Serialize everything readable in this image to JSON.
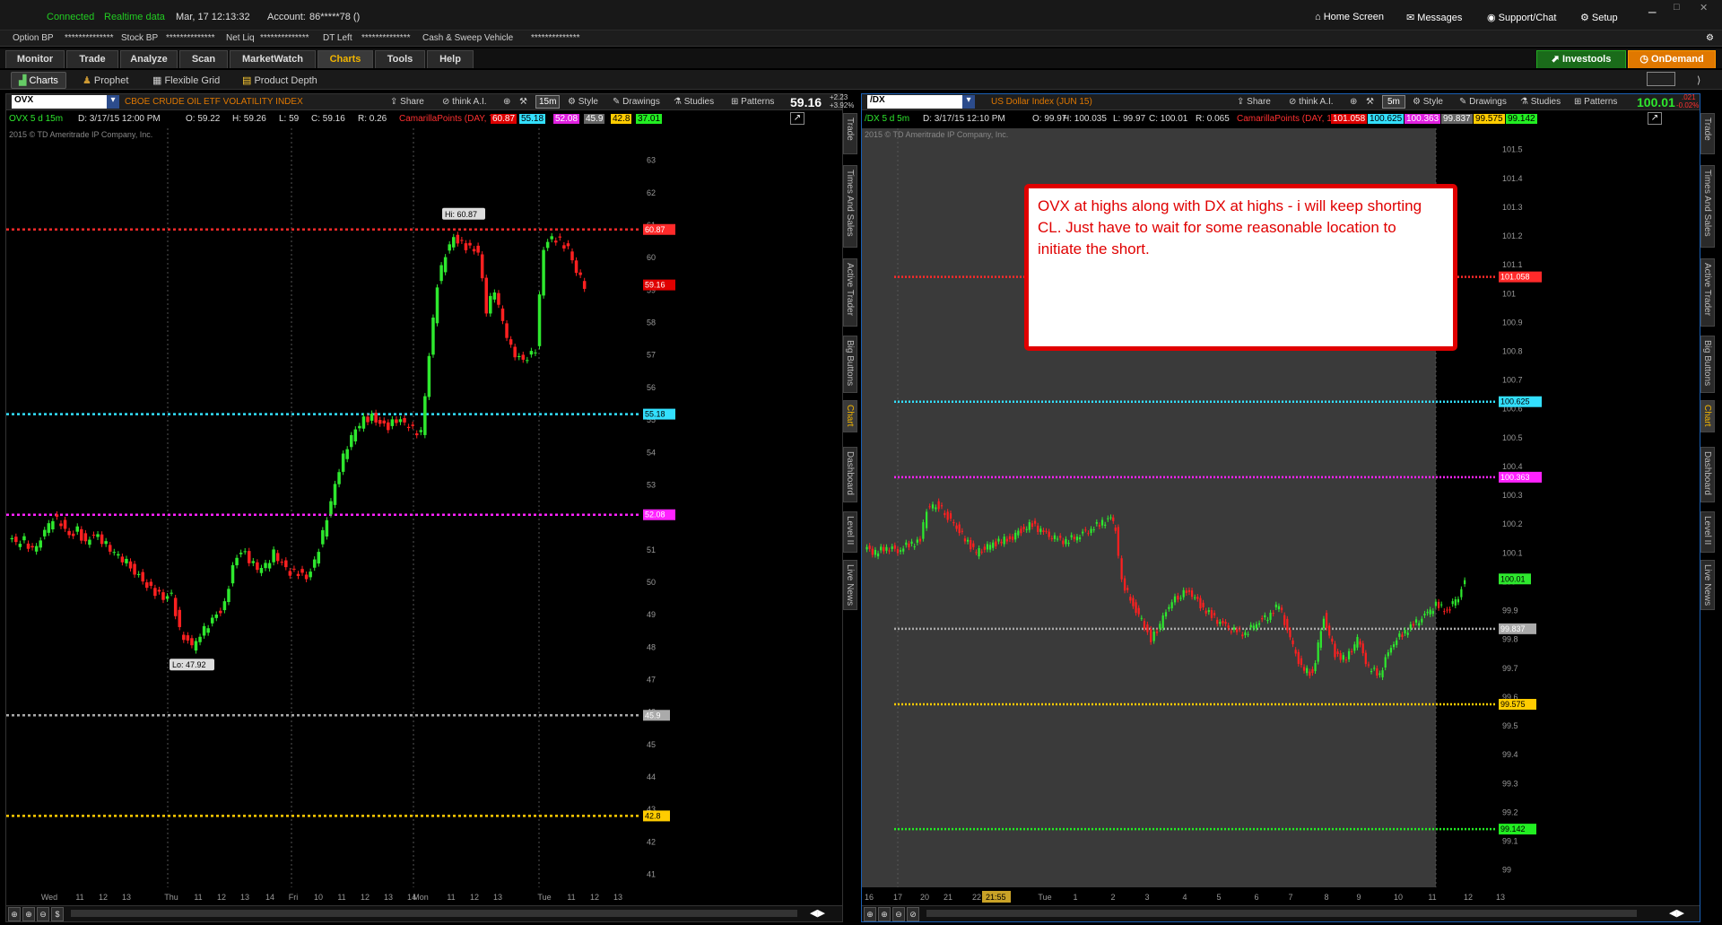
{
  "topbar": {
    "connected": "Connected",
    "realtime": "Realtime data",
    "datetime": "Mar, 17  12:13:32",
    "account_label": "Account:",
    "account_value": "86*****78 ()",
    "home": "Home Screen",
    "messages": "Messages",
    "support": "Support/Chat",
    "setup": "Setup"
  },
  "accbar": {
    "option_bp": "Option BP",
    "option_bp_val": "**************",
    "stock_bp": "Stock BP",
    "stock_bp_val": "**************",
    "net_liq": "Net Liq",
    "net_liq_val": "**************",
    "dt_left": "DT Left",
    "dt_left_val": "**************",
    "cash": "Cash & Sweep Vehicle",
    "cash_val": "**************"
  },
  "nav": {
    "tabs": [
      "Monitor",
      "Trade",
      "Analyze",
      "Scan",
      "MarketWatch",
      "Charts",
      "Tools",
      "Help"
    ],
    "active": "Charts",
    "investools": "Investools",
    "ondemand": "OnDemand"
  },
  "subnav": {
    "charts": "Charts",
    "prophet": "Prophet",
    "flexible": "Flexible Grid",
    "depth": "Product Depth"
  },
  "toolbar": {
    "share": "Share",
    "thinkai": "think A.I.",
    "style": "Style",
    "drawings": "Drawings",
    "studies": "Studies",
    "patterns": "Patterns"
  },
  "sidetabs": [
    "Trade",
    "Times And Sales",
    "Active Trader",
    "Big Buttons",
    "Chart",
    "Dashboard",
    "Level II",
    "Live News"
  ],
  "left": {
    "symbol": "OVX",
    "desc": "CBOE CRUDE OIL ETF VOLATILITY INDEX",
    "timeframe": "15m",
    "price": "59.16",
    "chg1": "+2.23",
    "chg2": "+3.92%",
    "info": {
      "label": "OVX 5 d 15m",
      "date": "D: 3/17/15 12:00 PM",
      "o": "O: 59.22",
      "h": "H: 59.26",
      "l": "L: 59",
      "c": "C: 59.16",
      "r": "R: 0.26",
      "cam": "CamarillaPoints (DAY, 7)",
      "v1": "60.87",
      "v2": "55.18",
      "v3": "52.08",
      "v4": "45.9",
      "v5": "42.8",
      "v6": "37.01"
    },
    "copyright": "2015 © TD Ameritrade IP Company, Inc.",
    "hi_label": "Hi: 60.87",
    "lo_label": "Lo: 47.92",
    "axis": [
      "63",
      "62",
      "61",
      "60",
      "59",
      "58",
      "57",
      "56",
      "55",
      "54",
      "53",
      "52",
      "51",
      "50",
      "49",
      "48",
      "47",
      "46",
      "45",
      "44",
      "43",
      "42",
      "41"
    ],
    "xticks": [
      "Wed",
      "11",
      "12",
      "13",
      "Thu",
      "11",
      "12",
      "13",
      "14",
      "Fri",
      "10",
      "11",
      "12",
      "13",
      "14",
      "Mon",
      "11",
      "12",
      "13",
      "Tue",
      "11",
      "12",
      "13"
    ]
  },
  "right": {
    "symbol": "/DX",
    "desc": "US Dollar Index (JUN 15)",
    "timeframe": "5m",
    "price": "100.01",
    "chg1": ".021",
    "chg2": "-0.02%",
    "info": {
      "label": "/DX 5 d 5m",
      "date": "D: 3/17/15 12:10 PM",
      "o": "O: 99.97",
      "h": "H: 100.035",
      "l": "L: 99.97",
      "c": "C: 100.01",
      "r": "R: 0.065",
      "cam": "CamarillaPoints (DAY, 1)",
      "v1": "101.058",
      "v2": "100.625",
      "v3": "100.363",
      "v4": "99.837",
      "v5": "99.575",
      "v6": "99.142"
    },
    "copyright": "2015 © TD Ameritrade IP Company, Inc.",
    "axis": [
      "101.5",
      "101.4",
      "101.3",
      "101.2",
      "101.1",
      "101",
      "100.9",
      "100.8",
      "100.7",
      "100.6",
      "100.5",
      "100.4",
      "100.3",
      "100.2",
      "100.1",
      "100",
      "99.9",
      "99.8",
      "99.7",
      "99.6",
      "99.5",
      "99.4",
      "99.3",
      "99.2",
      "99.1",
      "99"
    ],
    "xticks": [
      "16",
      "17",
      "20",
      "21",
      "22",
      "23",
      "Tue",
      "1",
      "2",
      "3",
      "4",
      "5",
      "6",
      "7",
      "8",
      "9",
      "10",
      "11",
      "12",
      "13"
    ],
    "time_badge": "21:55"
  },
  "annotation": "OVX at highs along with DX at highs - i will keep shorting CL. Just have to wait for some reasonable location to initiate the short.",
  "chart_data": [
    {
      "type": "candlestick",
      "title": "CBOE CRUDE OIL ETF VOLATILITY INDEX",
      "symbol": "OVX",
      "ylim": [
        40.6,
        63.6
      ],
      "levels": [
        {
          "name": "R1",
          "value": 60.87,
          "color": "#ff2a2a"
        },
        {
          "name": "R2",
          "value": 55.18,
          "color": "#33e0ff"
        },
        {
          "name": "R3",
          "value": 52.08,
          "color": "#ff22ff"
        },
        {
          "name": "S1",
          "value": 45.9,
          "color": "#aaaaaa"
        },
        {
          "name": "S2",
          "value": 42.8,
          "color": "#ffcc00"
        }
      ],
      "last": 59.16,
      "high": 60.87,
      "low": 47.92,
      "path": [
        51.4,
        51.2,
        51.3,
        51.0,
        51.5,
        52.0,
        51.8,
        51.4,
        51.6,
        51.2,
        51.5,
        51.3,
        51.0,
        50.8,
        50.5,
        50.2,
        49.9,
        49.7,
        49.5,
        49.6,
        48.5,
        48.0,
        48.4,
        48.7,
        48.8,
        49.0,
        49.3,
        50.5,
        51.0,
        50.7,
        50.4,
        50.5,
        50.9,
        50.6,
        50.3,
        50.3,
        50.1,
        50.6,
        51.5,
        52.5,
        53.5,
        54.2,
        54.7,
        55.0,
        55.1,
        54.9,
        54.8,
        55.0,
        54.9,
        54.7,
        54.6,
        57.0,
        59.2,
        60.1,
        60.6,
        60.4,
        60.3,
        60.2,
        58.4,
        59.0,
        58.0,
        57.2,
        56.9,
        56.9,
        57.2,
        60.3,
        60.6,
        60.5,
        60.3,
        59.6,
        59.16
      ],
      "x_at": [
        0,
        4,
        8,
        12,
        18,
        22,
        26,
        30,
        34,
        38,
        42,
        46,
        50,
        54,
        60,
        64,
        68,
        72,
        76,
        80,
        84,
        90,
        94,
        98,
        100,
        102,
        106,
        110,
        114,
        118,
        122,
        126,
        130,
        134,
        138,
        142,
        146,
        150,
        154,
        158,
        162,
        166,
        170,
        174,
        178,
        182,
        186,
        190,
        194,
        198,
        202,
        206,
        210,
        214,
        218,
        222,
        226,
        230,
        234,
        238,
        242,
        246,
        250,
        254,
        258,
        262,
        266,
        270,
        274,
        278,
        282
      ]
    },
    {
      "type": "candlestick",
      "title": "US Dollar Index (JUN 15)",
      "symbol": "/DX",
      "ylim": [
        98.94,
        101.53
      ],
      "levels": [
        {
          "name": "R1",
          "value": 101.058,
          "color": "#ff2a2a"
        },
        {
          "name": "R2",
          "value": 100.625,
          "color": "#33e0ff"
        },
        {
          "name": "R3",
          "value": 100.363,
          "color": "#ff22ff"
        },
        {
          "name": "S1",
          "value": 99.837,
          "color": "#aaaaaa"
        },
        {
          "name": "S2",
          "value": 99.575,
          "color": "#ffcc00"
        },
        {
          "name": "S3",
          "value": 99.142,
          "color": "#22ee22"
        }
      ],
      "last": 100.01,
      "path": [
        100.12,
        100.1,
        100.12,
        100.11,
        100.13,
        100.14,
        100.25,
        100.27,
        100.24,
        100.2,
        100.15,
        100.1,
        100.12,
        100.14,
        100.15,
        100.18,
        100.2,
        100.17,
        100.15,
        100.14,
        100.16,
        100.18,
        100.2,
        100.22,
        100.18,
        100.0,
        99.92,
        99.85,
        99.8,
        99.85,
        99.92,
        99.95,
        99.97,
        99.92,
        99.88,
        99.85,
        99.83,
        99.82,
        99.86,
        99.88,
        99.92,
        99.8,
        99.7,
        99.68,
        99.88,
        99.75,
        99.73,
        99.8,
        99.7,
        99.68,
        99.78,
        99.82,
        99.85,
        99.88,
        99.92,
        99.9,
        99.95,
        100.01
      ],
      "x_at": [
        0,
        5,
        10,
        15,
        20,
        25,
        28,
        32,
        36,
        40,
        45,
        50,
        55,
        60,
        65,
        70,
        75,
        80,
        85,
        90,
        95,
        100,
        105,
        110,
        112,
        115,
        120,
        125,
        128,
        132,
        136,
        140,
        145,
        150,
        155,
        160,
        165,
        170,
        175,
        180,
        185,
        190,
        195,
        200,
        205,
        210,
        215,
        220,
        225,
        230,
        235,
        240,
        245,
        250,
        255,
        260,
        265,
        268
      ]
    }
  ]
}
